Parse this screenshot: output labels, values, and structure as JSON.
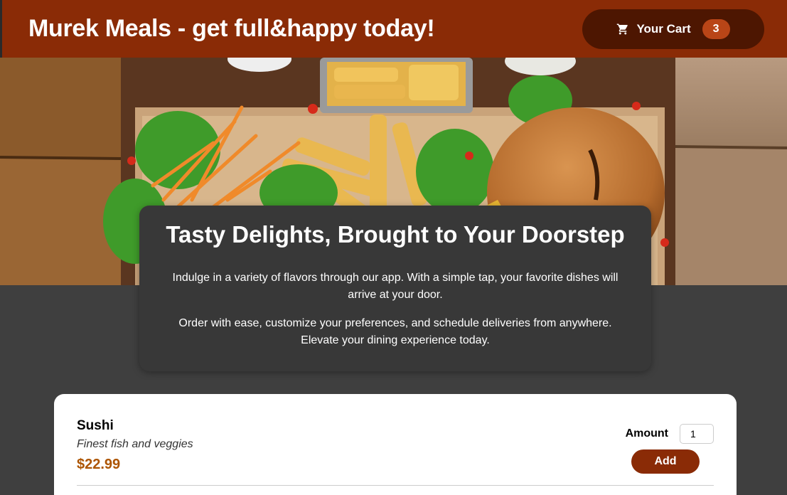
{
  "header": {
    "title": "Murek Meals - get full&happy today!",
    "cart_label": "Your Cart",
    "cart_count": "3",
    "cart_icon": "shopping-cart-icon"
  },
  "hero": {
    "image": "food-table-photo"
  },
  "summary": {
    "title": "Tasty Delights, Brought to Your Doorstep",
    "paragraph_1": "Indulge in a variety of flavors through our app. With a simple tap, your favorite dishes will arrive at your door.",
    "paragraph_2": "Order with ease, customize your preferences, and schedule deliveries from anywhere. Elevate your dining experience today."
  },
  "meals": [
    {
      "name": "Sushi",
      "description": "Finest fish and veggies",
      "price": "$22.99",
      "amount_label": "Amount",
      "amount_value": "1",
      "add_label": "Add"
    }
  ],
  "colors": {
    "header_bg": "#8a2b06",
    "cart_bg": "#4d1601",
    "badge_bg": "#b94517",
    "page_bg": "#3f3f3f",
    "price": "#ad5502"
  }
}
